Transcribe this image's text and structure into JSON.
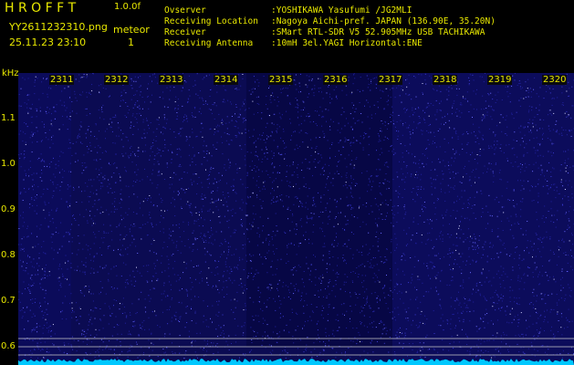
{
  "header": {
    "logo": "H R O F F T",
    "version": "1.0.0f",
    "filename": "YY2611232310.png",
    "meteor_label": "meteor",
    "datetime": "25.11.23 23:10",
    "meteor_count": "1"
  },
  "info": [
    {
      "label": "Ovserver",
      "value": ":YOSHIKAWA Yasufumi /JG2MLI"
    },
    {
      "label": "Receiving Location",
      "value": ":Nagoya Aichi-pref. JAPAN (136.90E, 35.20N)"
    },
    {
      "label": "Receiver",
      "value": ":SMart RTL-SDR V5 52.905MHz USB TACHIKAWA"
    },
    {
      "label": "Receiving Antenna",
      "value": ":10mH 3el.YAGI Horizontal:ENE"
    }
  ],
  "axes": {
    "y_unit": "kHz",
    "y_ticks": [
      "1.1",
      "1.0",
      "0.9",
      "0.8",
      "0.7",
      "0.6"
    ],
    "x_ticks": [
      "2311",
      "2312",
      "2313",
      "2314",
      "2315",
      "2316",
      "2317",
      "2318",
      "2319",
      "2320"
    ]
  },
  "colors": {
    "text": "#e8e800",
    "background": "#000000",
    "spectrum": "#0a0a60",
    "noise_trace": "#00c8ff"
  }
}
